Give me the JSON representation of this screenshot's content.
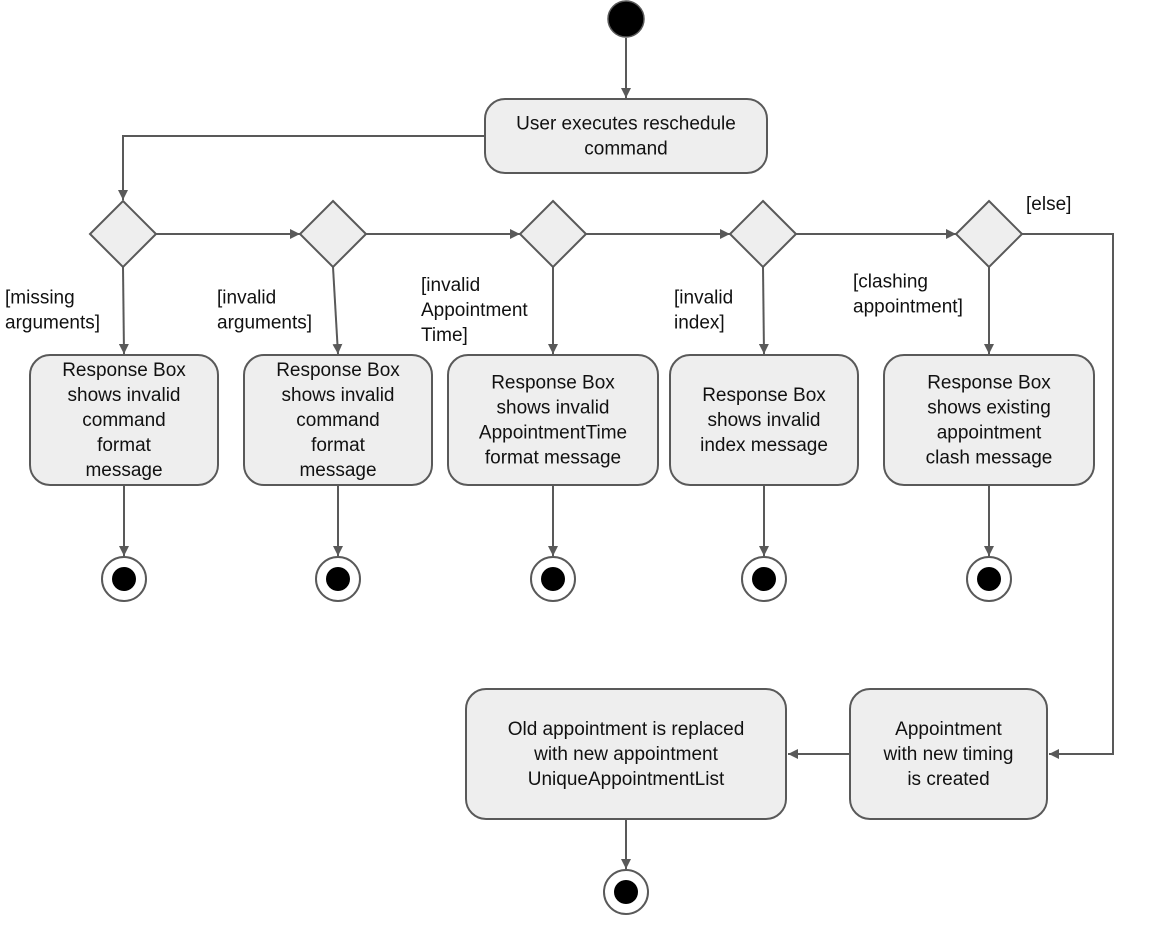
{
  "diagram": {
    "type": "activity-diagram",
    "colors": {
      "node_fill": "#eeeeee",
      "stroke": "#595959",
      "text": "#111111",
      "initial_node": "#000000"
    },
    "start_action": {
      "lines": [
        "User executes reschedule",
        "command"
      ]
    },
    "decisions": [
      {
        "guard_lines": [
          "[missing",
          "arguments]"
        ],
        "response_lines": [
          "Response Box",
          "shows invalid",
          "command",
          "format",
          "message"
        ]
      },
      {
        "guard_lines": [
          "[invalid",
          "arguments]"
        ],
        "response_lines": [
          "Response Box",
          "shows invalid",
          "command",
          "format",
          "message"
        ]
      },
      {
        "guard_lines": [
          "[invalid",
          "Appointment",
          "Time]"
        ],
        "response_lines": [
          "Response Box",
          "shows invalid",
          "AppointmentTime",
          "format message"
        ]
      },
      {
        "guard_lines": [
          "[invalid",
          "index]"
        ],
        "response_lines": [
          "Response Box",
          "shows invalid",
          "index message"
        ]
      },
      {
        "guard_lines": [
          "[clashing",
          "appointment]"
        ],
        "response_lines": [
          "Response Box",
          "shows existing",
          "appointment",
          "clash message"
        ]
      }
    ],
    "else_guard": "[else]",
    "create_action": {
      "lines": [
        "Appointment",
        "with new timing",
        "is created"
      ]
    },
    "replace_action": {
      "lines": [
        "Old appointment is replaced",
        "with new appointment",
        "UniqueAppointmentList"
      ]
    }
  }
}
